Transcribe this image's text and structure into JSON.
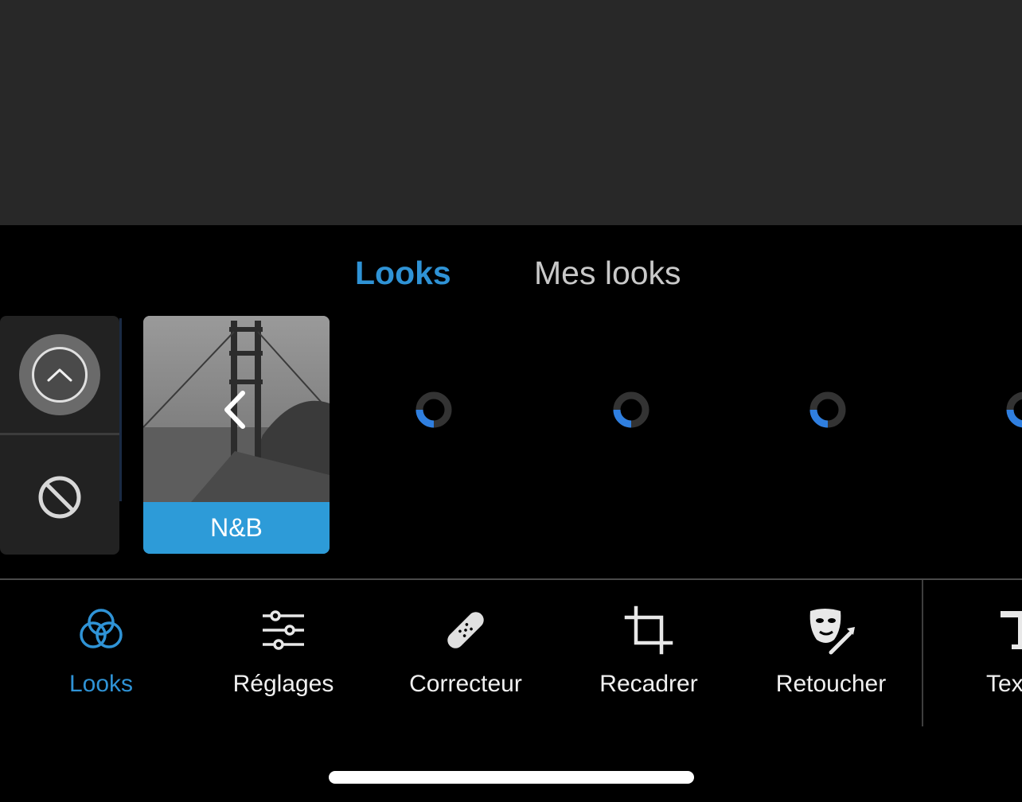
{
  "tabs": {
    "looks_label": "Looks",
    "mes_looks_label": "Mes looks"
  },
  "presets": {
    "selected_label": "N&B"
  },
  "toolbar": {
    "looks": "Looks",
    "reglages": "Réglages",
    "correcteur": "Correcteur",
    "recadrer": "Recadrer",
    "retoucher": "Retoucher",
    "texte": "Texte"
  },
  "colors": {
    "accent": "#2f93d6",
    "preset_label_bg": "#2d9bd8",
    "canvas_bg": "#282828",
    "panel_bg": "#222222"
  },
  "icons": {
    "up": "chevron-up-circle-icon",
    "none": "no-symbol-icon",
    "back": "chevron-left-icon",
    "looks": "three-circles-icon",
    "reglages": "sliders-icon",
    "correcteur": "bandage-icon",
    "recadrer": "crop-icon",
    "retoucher": "mask-brush-icon",
    "texte": "text-icon",
    "loading": "loading-spinner-icon"
  }
}
